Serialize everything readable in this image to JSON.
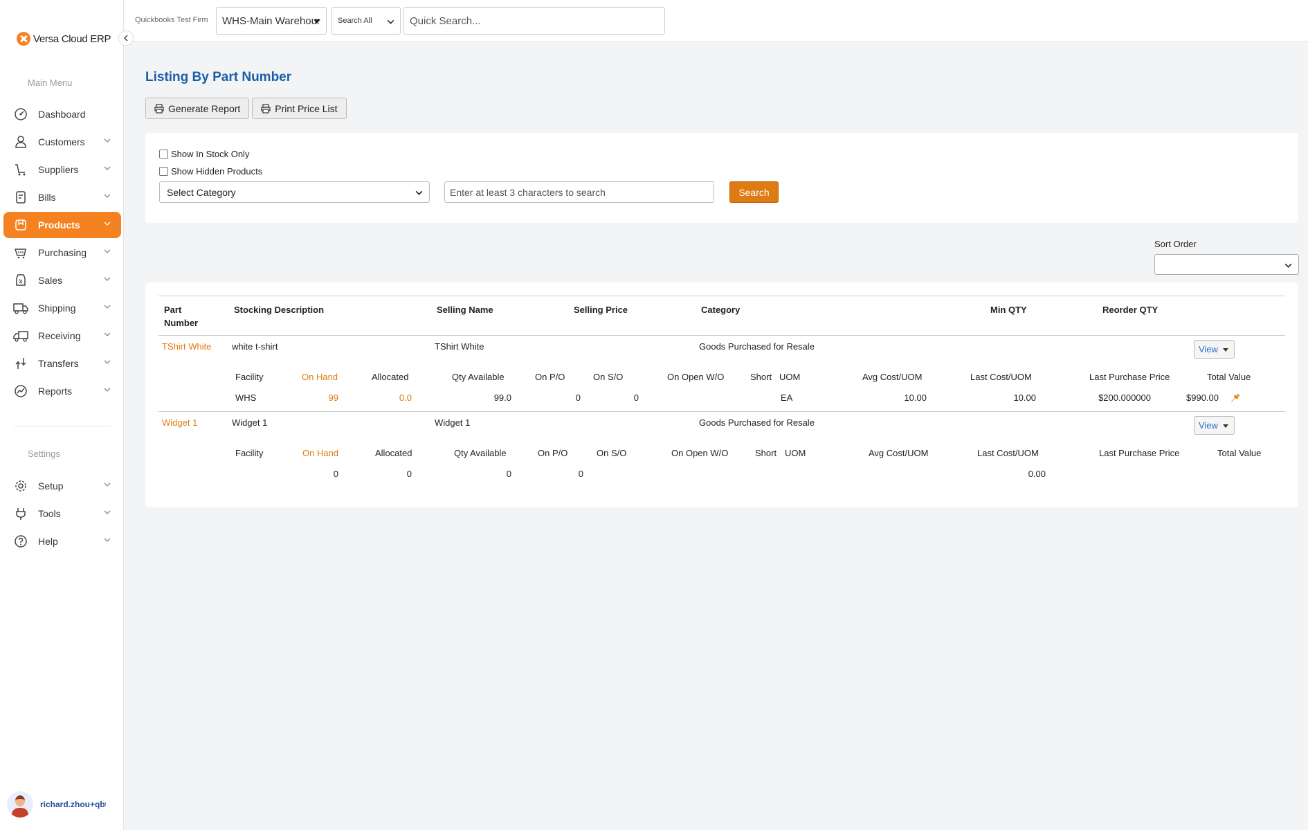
{
  "app": {
    "logo_text": "Versa Cloud ERP"
  },
  "topbar": {
    "firm_label": "Quickbooks Test Firm",
    "warehouse_value": "WHS-Main Warehou:",
    "search_scope": "Search All",
    "quick_search_placeholder": "Quick Search..."
  },
  "sidebar": {
    "main_heading": "Main Menu",
    "settings_heading": "Settings",
    "items": [
      {
        "label": "Dashboard",
        "icon": "dashboard-icon",
        "chevron": false,
        "active": false
      },
      {
        "label": "Customers",
        "icon": "user-icon",
        "chevron": true,
        "active": false
      },
      {
        "label": "Suppliers",
        "icon": "cart-icon",
        "chevron": true,
        "active": false
      },
      {
        "label": "Bills",
        "icon": "bill-icon",
        "chevron": true,
        "active": false
      },
      {
        "label": "Products",
        "icon": "products-icon",
        "chevron": true,
        "active": true
      },
      {
        "label": "Purchasing",
        "icon": "basket-icon",
        "chevron": true,
        "active": false
      },
      {
        "label": "Sales",
        "icon": "tag-icon",
        "chevron": true,
        "active": false
      },
      {
        "label": "Shipping",
        "icon": "truck-icon",
        "chevron": true,
        "active": false
      },
      {
        "label": "Receiving",
        "icon": "receiving-icon",
        "chevron": true,
        "active": false
      },
      {
        "label": "Transfers",
        "icon": "transfer-icon",
        "chevron": true,
        "active": false
      },
      {
        "label": "Reports",
        "icon": "reports-icon",
        "chevron": true,
        "active": false
      }
    ],
    "settings_items": [
      {
        "label": "Setup",
        "icon": "gear-icon",
        "chevron": true
      },
      {
        "label": "Tools",
        "icon": "plug-icon",
        "chevron": true
      },
      {
        "label": "Help",
        "icon": "help-icon",
        "chevron": true
      }
    ],
    "user_name": "richard.zhou+qbt"
  },
  "main": {
    "title": "Listing By Part Number",
    "generate_report_label": "Generate Report",
    "print_price_list_label": "Print Price List",
    "filters": {
      "in_stock_label": "Show In Stock Only",
      "hidden_label": "Show Hidden Products",
      "category_placeholder": "Select Category",
      "search_placeholder": "Enter at least 3 characters to search",
      "search_button": "Search"
    },
    "sort_order_label": "Sort Order",
    "table": {
      "headers": {
        "part_number": "Part Number",
        "stocking_description": "Stocking Description",
        "selling_name": "Selling Name",
        "selling_price": "Selling Price",
        "category": "Category",
        "min_qty": "Min QTY",
        "reorder_qty": "Reorder QTY"
      },
      "sub_headers": {
        "facility": "Facility",
        "on_hand": "On Hand",
        "allocated": "Allocated",
        "qty_available": "Qty Available",
        "on_po": "On P/O",
        "on_so": "On S/O",
        "on_open_wo": "On Open W/O",
        "short": "Short",
        "uom": "UOM",
        "avg_cost": "Avg Cost/UOM",
        "last_cost": "Last Cost/UOM",
        "last_purchase_price": "Last Purchase Price",
        "total_value": "Total Value"
      },
      "view_label": "View",
      "rows": [
        {
          "part_number": "TShirt White",
          "stocking_description": "white t-shirt",
          "selling_name": "TShirt White",
          "category": "Goods Purchased for Resale",
          "detail": {
            "facility": "WHS",
            "on_hand": "99",
            "allocated": "0.0",
            "qty_available": "99.0",
            "on_po": "0",
            "on_so": "0",
            "uom": "EA",
            "avg_cost": "10.00",
            "last_cost": "10.00",
            "last_purchase_price": "$200.000000",
            "total_value": "$990.00"
          }
        },
        {
          "part_number": "Widget 1",
          "stocking_description": "Widget 1",
          "selling_name": "Widget 1",
          "category": "Goods Purchased for Resale",
          "detail": {
            "on_hand": "0",
            "allocated": "0",
            "qty_available": "0",
            "on_po": "0",
            "last_cost": "0.00"
          }
        }
      ]
    }
  },
  "colors": {
    "accent": "#f58220",
    "title_blue": "#1c5da8",
    "link_orange": "#e07b0f"
  }
}
